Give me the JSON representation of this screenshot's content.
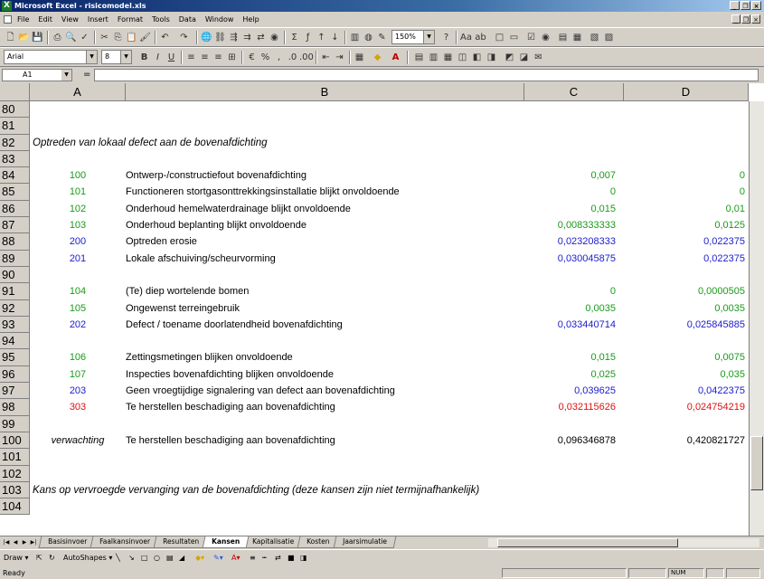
{
  "window": {
    "title": "Microsoft Excel - risicomodel.xls"
  },
  "menu": [
    "File",
    "Edit",
    "View",
    "Insert",
    "Format",
    "Tools",
    "Data",
    "Window",
    "Help"
  ],
  "toolbar": {
    "zoom": "150%",
    "font": "Arial",
    "size": "8"
  },
  "formula_bar": {
    "name_box": "A1",
    "formula_label": "=",
    "content": ""
  },
  "columns": [
    "A",
    "B",
    "C",
    "D"
  ],
  "rows": [
    {
      "num": "80",
      "a": "",
      "b": "",
      "c": "",
      "d": "",
      "color": "black"
    },
    {
      "num": "81",
      "a": "",
      "b": "",
      "c": "",
      "d": "",
      "color": "black"
    },
    {
      "num": "82",
      "header": "Optreden van lokaal defect aan de bovenafdichting"
    },
    {
      "num": "83",
      "a": "",
      "b": "",
      "c": "",
      "d": "",
      "color": "black"
    },
    {
      "num": "84",
      "a": "100",
      "b": "Ontwerp-/constructiefout bovenafdichting",
      "c": "0,007",
      "d": "0",
      "color": "green"
    },
    {
      "num": "85",
      "a": "101",
      "b": "Functioneren stortgasonttrekkingsinstallatie blijkt onvoldoende",
      "c": "0",
      "d": "0",
      "color": "green"
    },
    {
      "num": "86",
      "a": "102",
      "b": "Onderhoud hemelwaterdrainage blijkt onvoldoende",
      "c": "0,015",
      "d": "0,01",
      "color": "green"
    },
    {
      "num": "87",
      "a": "103",
      "b": "Onderhoud beplanting blijkt onvoldoende",
      "c": "0,008333333",
      "d": "0,0125",
      "color": "green"
    },
    {
      "num": "88",
      "a": "200",
      "b": "Optreden erosie",
      "c": "0,023208333",
      "d": "0,022375",
      "color": "blue"
    },
    {
      "num": "89",
      "a": "201",
      "b": "Lokale afschuiving/scheurvorming",
      "c": "0,030045875",
      "d": "0,022375",
      "color": "blue"
    },
    {
      "num": "90",
      "a": "",
      "b": "",
      "c": "",
      "d": "",
      "color": "black"
    },
    {
      "num": "91",
      "a": "104",
      "b": "(Te) diep wortelende bomen",
      "c": "0",
      "d": "0,0000505",
      "color": "green"
    },
    {
      "num": "92",
      "a": "105",
      "b": "Ongewenst terreingebruik",
      "c": "0,0035",
      "d": "0,0035",
      "color": "green"
    },
    {
      "num": "93",
      "a": "202",
      "b": "Defect / toename doorlatendheid bovenafdichting",
      "c": "0,033440714",
      "d": "0,025845885",
      "color": "blue"
    },
    {
      "num": "94",
      "a": "",
      "b": "",
      "c": "",
      "d": "",
      "color": "black"
    },
    {
      "num": "95",
      "a": "106",
      "b": "Zettingsmetingen blijken onvoldoende",
      "c": "0,015",
      "d": "0,0075",
      "color": "green"
    },
    {
      "num": "96",
      "a": "107",
      "b": "Inspecties bovenafdichting blijken onvoldoende",
      "c": "0,025",
      "d": "0,035",
      "color": "green"
    },
    {
      "num": "97",
      "a": "203",
      "b": "Geen vroegtijdige signalering van defect aan bovenafdichting",
      "c": "0,039625",
      "d": "0,0422375",
      "color": "blue"
    },
    {
      "num": "98",
      "a": "303",
      "b": "Te herstellen beschadiging aan bovenafdichting",
      "c": "0,032115626",
      "d": "0,024754219",
      "color": "red"
    },
    {
      "num": "99",
      "a": "",
      "b": "",
      "c": "",
      "d": "",
      "color": "black"
    },
    {
      "num": "100",
      "a": "verwachting",
      "b": "Te herstellen beschadiging aan bovenafdichting",
      "c": "0,096346878",
      "d": "0,420821727",
      "color": "black"
    },
    {
      "num": "101",
      "a": "",
      "b": "",
      "c": "",
      "d": "",
      "color": "black"
    },
    {
      "num": "102",
      "a": "",
      "b": "",
      "c": "",
      "d": "",
      "color": "black"
    },
    {
      "num": "103",
      "header": "Kans op vervroegde vervanging van de bovenafdichting (deze kansen zijn niet termijnafhankelijk)"
    },
    {
      "num": "104",
      "a": "",
      "b": "",
      "c": "",
      "d": "",
      "color": "black"
    }
  ],
  "sheet_tabs": [
    "Basisinvoer",
    "Faalkansinvoer",
    "Resultaten",
    "Kansen",
    "Kapitalisatie",
    "Kosten",
    "Jaarsimulatie"
  ],
  "active_tab": "Kansen",
  "drawing": {
    "draw": "Draw",
    "autoshapes": "AutoShapes"
  },
  "status": {
    "ready": "Ready",
    "num": "NUM"
  }
}
